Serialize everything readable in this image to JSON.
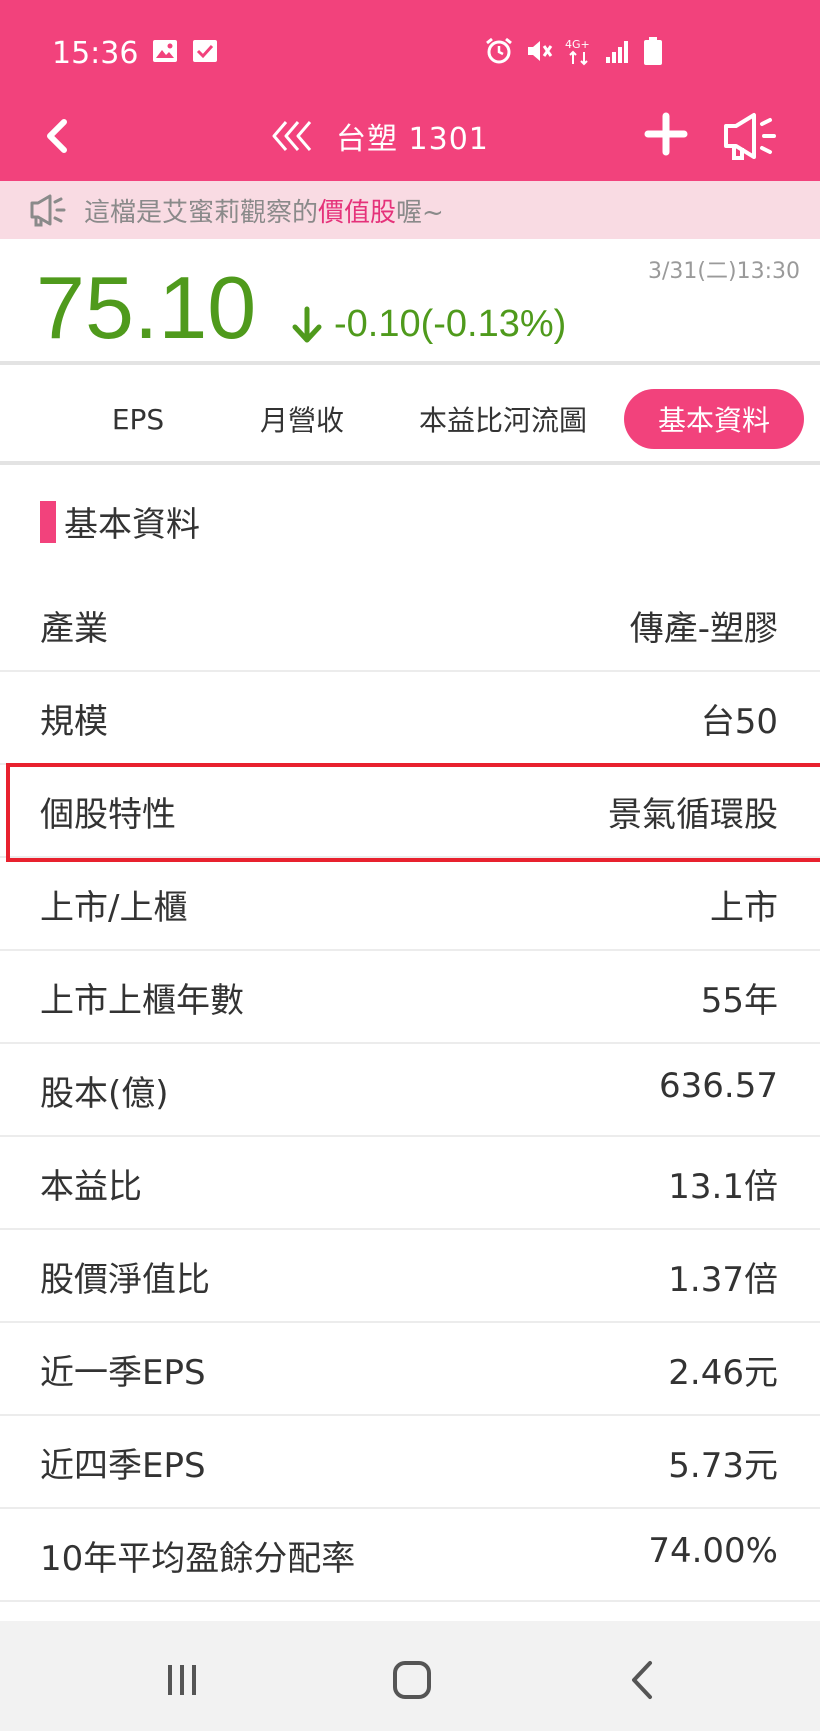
{
  "status_bar": {
    "time": "15:36",
    "left_icons": [
      "image-icon",
      "check-box-icon"
    ],
    "right_icons": [
      "alarm-icon",
      "mute-icon",
      "4g-signal-icon",
      "signal-bars-icon",
      "battery-icon"
    ],
    "network_label": "4G+"
  },
  "nav": {
    "title": "台塑 1301",
    "back_icon": "chevron-left-icon",
    "history_icon": "triple-chevron-left-icon",
    "add_icon": "plus-icon",
    "speaker_icon": "megaphone-icon"
  },
  "announcement": {
    "prefix": "這檔是艾蜜莉觀察的",
    "highlight": "價值股",
    "suffix": "喔~"
  },
  "quote": {
    "price": "75.10",
    "change": "-0.10(-0.13%)",
    "direction_icon": "arrow-down-icon",
    "timestamp": "3/31(二)13:30"
  },
  "tabs": [
    {
      "label": "EPS",
      "active": false
    },
    {
      "label": "月營收",
      "active": false
    },
    {
      "label": "本益比河流圖",
      "active": false
    },
    {
      "label": "基本資料",
      "active": true
    }
  ],
  "section": {
    "title": "基本資料"
  },
  "rows": [
    {
      "label": "產業",
      "value": "傳產-塑膠"
    },
    {
      "label": "規模",
      "value": "台50"
    },
    {
      "label": "個股特性",
      "value": "景氣循環股",
      "highlighted": true
    },
    {
      "label": "上市/上櫃",
      "value": "上市"
    },
    {
      "label": "上市上櫃年數",
      "value": "55年"
    },
    {
      "label": "股本(億)",
      "value": "636.57"
    },
    {
      "label": "本益比",
      "value": "13.1倍"
    },
    {
      "label": "股價淨值比",
      "value": "1.37倍"
    },
    {
      "label": "近一季EPS",
      "value": "2.46元"
    },
    {
      "label": "近四季EPS",
      "value": "5.73元"
    },
    {
      "label": "10年平均盈餘分配率",
      "value": "74.00%"
    }
  ],
  "colors": {
    "brand_pink": "#f2427c",
    "price_green": "#4f9a1c",
    "highlight_red": "#e8212e"
  },
  "system_nav": [
    "recents-icon",
    "home-icon",
    "back-icon"
  ]
}
